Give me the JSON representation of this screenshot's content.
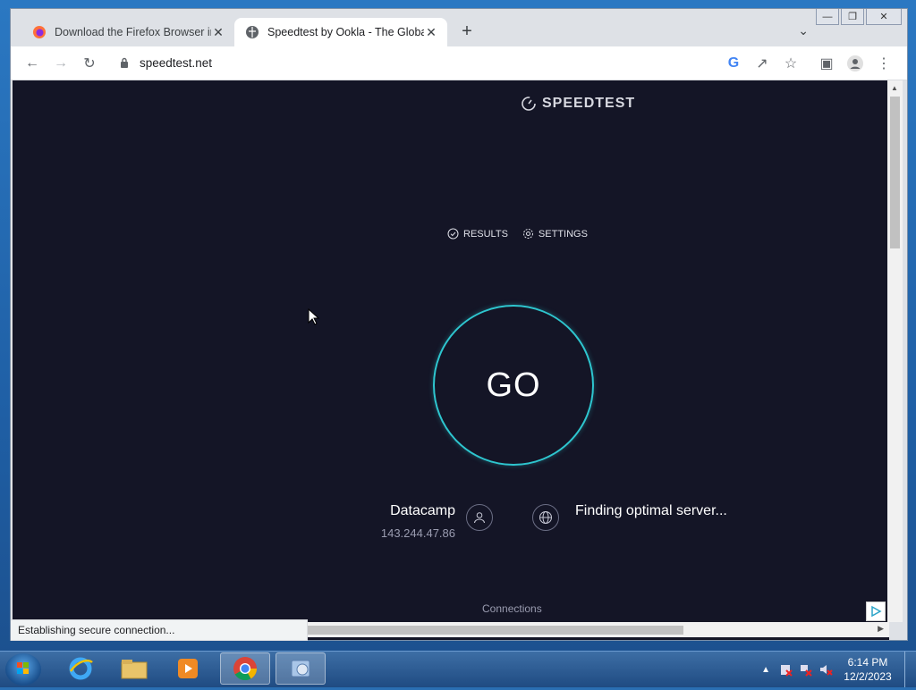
{
  "browser": {
    "tabs": [
      {
        "title": "Download the Firefox Browser in",
        "icon": "firefox-icon",
        "active": false
      },
      {
        "title": "Speedtest by Ookla - The Global",
        "icon": "globe-icon",
        "active": true
      }
    ],
    "url": "speedtest.net",
    "status_text": "Establishing secure connection..."
  },
  "page": {
    "logo": "SPEEDTEST",
    "nav": {
      "results": "RESULTS",
      "settings": "SETTINGS"
    },
    "go_label": "GO",
    "isp_name": "Datacamp",
    "ip": "143.244.47.86",
    "server_status": "Finding optimal server...",
    "connections_label": "Connections",
    "accent_color": "#2ec6cf"
  },
  "taskbar": {
    "time": "6:14 PM",
    "date": "12/2/2023"
  }
}
